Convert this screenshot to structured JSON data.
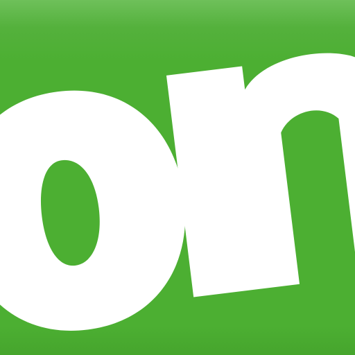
{
  "app_icon": {
    "logo_text": "om",
    "background_color": "#4caf32",
    "highlight_color": "#6ec05a",
    "letter_color": "#ffffff"
  }
}
